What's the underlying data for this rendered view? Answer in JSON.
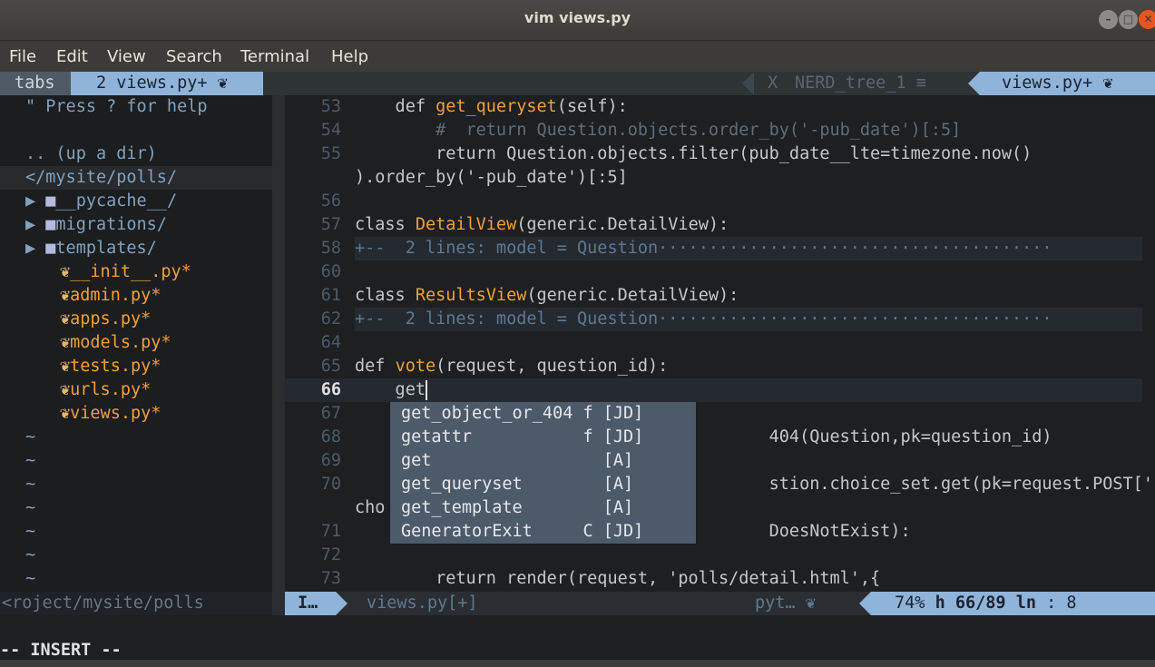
{
  "window": {
    "title": "vim views.py"
  },
  "menu": [
    "File",
    "Edit",
    "View",
    "Search",
    "Terminal",
    "Help"
  ],
  "tabline": {
    "tabs_label": "tabs",
    "current_tab": "2 views.py+ ",
    "x_label": "X",
    "nerd_tab": "NERD_tree_1 ≡",
    "views_tab": "views.py+ "
  },
  "nerdtree": {
    "help": "\" Press ? for help",
    "up": ".. (up a dir)",
    "cwd": "</mysite/polls/",
    "dirs": [
      "__pycache__/",
      "migrations/",
      "templates/"
    ],
    "files": [
      "__init__.py*",
      "admin.py*",
      "apps.py*",
      "models.py*",
      "tests.py*",
      "urls.py*",
      "views.py*"
    ]
  },
  "editor": {
    "lines": [
      {
        "n": "53",
        "pre": "    def ",
        "fn": "get_queryset",
        "post": "(self):"
      },
      {
        "n": "54",
        "comment": "        #  return Question.objects.order_by('-pub_date')[:5]"
      },
      {
        "n": "55",
        "text": "        return Question.objects.filter(pub_date__lte=timezone.now()"
      },
      {
        "n": "",
        "text": ").order_by('-pub_date')[:5]"
      },
      {
        "n": "56",
        "text": ""
      },
      {
        "n": "57",
        "pre": "class ",
        "fn": "DetailView",
        "post": "(generic.DetailView):"
      },
      {
        "n": "58",
        "fold": "+--  2 lines: model = Question·······································"
      },
      {
        "n": "60",
        "text": ""
      },
      {
        "n": "61",
        "pre": "class ",
        "fn": "ResultsView",
        "post": "(generic.DetailView):"
      },
      {
        "n": "62",
        "fold": "+--  2 lines: model = Question·······································"
      },
      {
        "n": "64",
        "text": ""
      },
      {
        "n": "65",
        "pre": "def ",
        "fn": "vote",
        "post": "(request, question_id):"
      },
      {
        "n": "66",
        "text": "    get",
        "current": true
      },
      {
        "n": "67",
        "text": ""
      },
      {
        "n": "68",
        "text": "                                         404(Question,pk=question_id)"
      },
      {
        "n": "69",
        "text": ""
      },
      {
        "n": "70",
        "text": "                                         stion.choice_set.get(pk=request.POST['"
      },
      {
        "n": "",
        "text": "cho"
      },
      {
        "n": "71",
        "text": "                                         DoesNotExist):"
      },
      {
        "n": "72",
        "text": ""
      },
      {
        "n": "73",
        "text": "        return render(request, 'polls/detail.html',{"
      }
    ]
  },
  "completion": [
    {
      "word": "get_object_or_404",
      "kind": "f",
      "src": "[JD]"
    },
    {
      "word": "getattr",
      "kind": "f",
      "src": "[JD]"
    },
    {
      "word": "get",
      "kind": "",
      "src": "[A]"
    },
    {
      "word": "get_queryset",
      "kind": "",
      "src": "[A]"
    },
    {
      "word": "get_template",
      "kind": "",
      "src": "[A]"
    },
    {
      "word": "GeneratorExit",
      "kind": "C",
      "src": "[JD]"
    }
  ],
  "status": {
    "path": "<roject/mysite/polls",
    "mode": "I…",
    "file": "views.py[+]",
    "filetype": "pyt… ",
    "percent": "74%",
    "pos": "66/89",
    "ln": "ln",
    "col": ":  8"
  },
  "cmdline": "-- INSERT --"
}
